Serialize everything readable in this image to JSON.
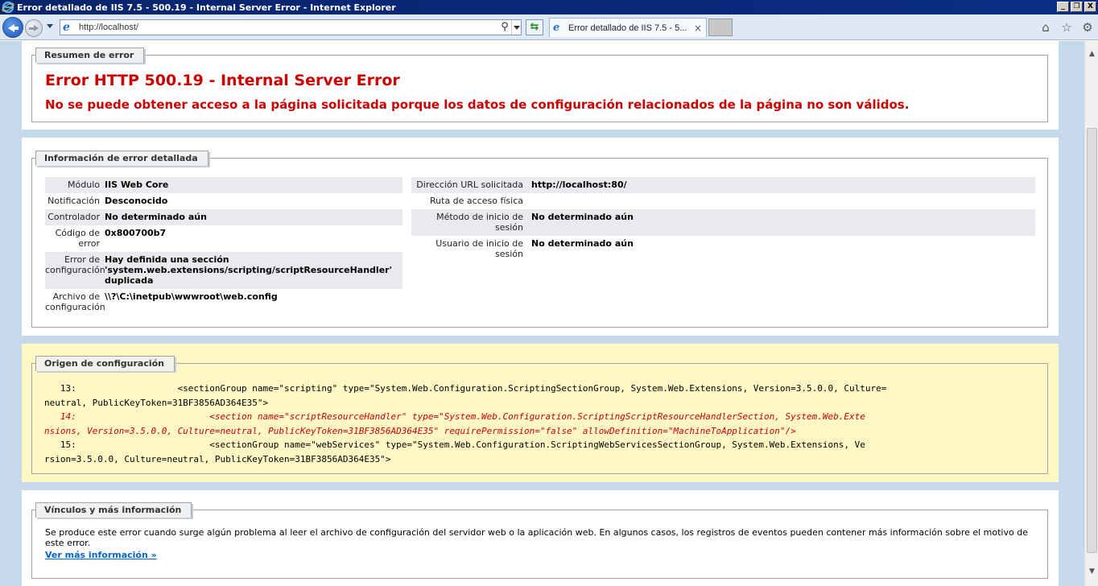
{
  "window": {
    "title": "Error detallado de IIS 7.5 - 500.19 - Internal Server Error - Internet Explorer",
    "minimize": "_",
    "restore": "❐",
    "close": "X"
  },
  "nav": {
    "address": "http://localhost/",
    "tab_label": "Error detallado de IIS 7.5 - 5...",
    "tab_close": "×"
  },
  "summary": {
    "legend": "Resumen de error",
    "title": "Error HTTP 500.19 - Internal Server Error",
    "subtitle": "No se puede obtener acceso a la página solicitada porque los datos de configuración relacionados de la página no son válidos."
  },
  "details": {
    "legend": "Información de error detallada",
    "left": [
      {
        "label": "Módulo",
        "value": "IIS Web Core"
      },
      {
        "label": "Notificación",
        "value": "Desconocido"
      },
      {
        "label": "Controlador",
        "value": "No determinado aún"
      },
      {
        "label_lines": [
          "Código de",
          "error"
        ],
        "value": "0x800700b7"
      },
      {
        "label_lines": [
          "Error de",
          "configuración"
        ],
        "value_lines": [
          "Hay definida una sección",
          "'system.web.extensions/scripting/scriptResourceHandler'",
          "duplicada"
        ]
      },
      {
        "label_lines": [
          "Archivo de",
          "configuración"
        ],
        "value": "\\\\?\\C:\\inetpub\\wwwroot\\web.config"
      }
    ],
    "right": [
      {
        "label": "Dirección URL solicitada",
        "value": "http://localhost:80/"
      },
      {
        "label": "Ruta de acceso física",
        "value": ""
      },
      {
        "label_lines": [
          "Método de inicio de",
          "sesión"
        ],
        "value": "No determinado aún"
      },
      {
        "label_lines": [
          "Usuario de inicio de",
          "sesión"
        ],
        "value": "No determinado aún"
      }
    ]
  },
  "config_source": {
    "legend": "Origen de configuración",
    "lines": [
      {
        "text": "   13:                   <sectionGroup name=\"scripting\" type=\"System.Web.Configuration.ScriptingSectionGroup, System.Web.Extensions, Version=3.5.0.0, Culture=",
        "highlight": false
      },
      {
        "text": "neutral, PublicKeyToken=31BF3856AD364E35\">",
        "highlight": false
      },
      {
        "text": "   14:                         <section name=\"scriptResourceHandler\" type=\"System.Web.Configuration.ScriptingScriptResourceHandlerSection, System.Web.Exte",
        "highlight": true
      },
      {
        "text": "nsions, Version=3.5.0.0, Culture=neutral, PublicKeyToken=31BF3856AD364E35\" requirePermission=\"false\" allowDefinition=\"MachineToApplication\"/>",
        "highlight": true
      },
      {
        "text": "   15:                         <sectionGroup name=\"webServices\" type=\"System.Web.Configuration.ScriptingWebServicesSectionGroup, System.Web.Extensions, Ve",
        "highlight": false
      },
      {
        "text": "rsion=3.5.0.0, Culture=neutral, PublicKeyToken=31BF3856AD364E35\">",
        "highlight": false
      }
    ]
  },
  "links": {
    "legend": "Vínculos y más información",
    "text": "Se produce este error cuando surge algún problema al leer el archivo de configuración del servidor web o la aplicación web. En algunos casos, los registros de eventos pueden contener más información sobre el motivo de este error.",
    "more": "Ver más información »"
  },
  "colors": {
    "error_red": "#cc0000",
    "link_blue": "#0066cc",
    "page_bg": "#c6d9eb",
    "config_bg": "#fff8c4",
    "titlebar": "#0a246a"
  }
}
